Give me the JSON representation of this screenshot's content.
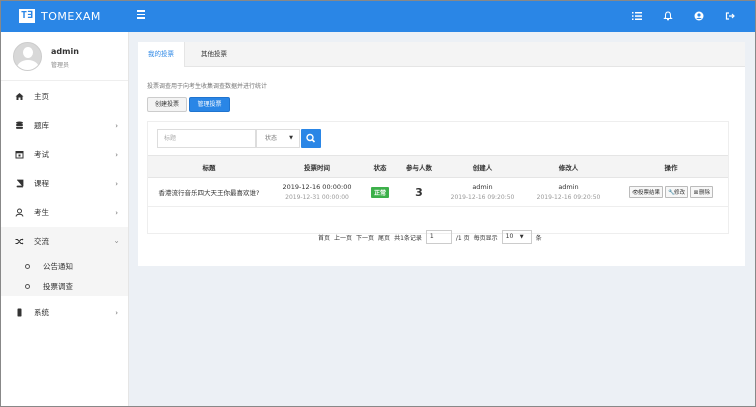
{
  "header": {
    "logo_mark": "T∃",
    "title": "TOMEXAM",
    "icons": [
      "menu-icon",
      "list-icon",
      "bell-icon",
      "user-circle-icon",
      "logout-icon"
    ]
  },
  "user": {
    "name": "admin",
    "role": "管理员"
  },
  "sidebar": {
    "items": [
      {
        "label": "主页",
        "icon": "home-icon"
      },
      {
        "label": "题库",
        "icon": "database-icon"
      },
      {
        "label": "考试",
        "icon": "calendar-icon"
      },
      {
        "label": "课程",
        "icon": "book-icon"
      },
      {
        "label": "考生",
        "icon": "user-icon"
      },
      {
        "label": "交流",
        "icon": "shuffle-icon"
      },
      {
        "label": "系统",
        "icon": "mobile-icon"
      }
    ],
    "sub_items": [
      "公告通知",
      "投票调查"
    ]
  },
  "main": {
    "tabs": [
      "我的投票",
      "其他投票"
    ],
    "description": "投票调查用于向考生收集调查数据并进行统计",
    "create_label": "创建投票",
    "manage_label": "管理投票",
    "title_placeholder": "标题",
    "status_select": "状态",
    "table": {
      "headers": [
        "标题",
        "投票时间",
        "状态",
        "参与人数",
        "创建人",
        "修改人",
        "操作"
      ],
      "rows": [
        {
          "title": "香港流行音乐四大天王你最喜欢谁?",
          "time_start": "2019-12-16 00:00:00",
          "time_end": "2019-12-31 00:00:00",
          "status": "正常",
          "count": "3",
          "creator": "admin",
          "created_at": "2019-12-16 09:20:50",
          "modifier": "admin",
          "modified_at": "2019-12-16 09:20:50",
          "ops": [
            "投票结果",
            "修改",
            "删除"
          ]
        }
      ]
    },
    "pager": {
      "first": "首页",
      "prev": "上一页",
      "next": "下一页",
      "last": "尾页",
      "total": "共1条记录",
      "page": "1",
      "pages": "/1 页",
      "per_page_label": "每页显示",
      "per_page": "10",
      "unit": "条"
    }
  },
  "colors": {
    "accent": "#2a86e6",
    "success": "#3cb04a"
  }
}
